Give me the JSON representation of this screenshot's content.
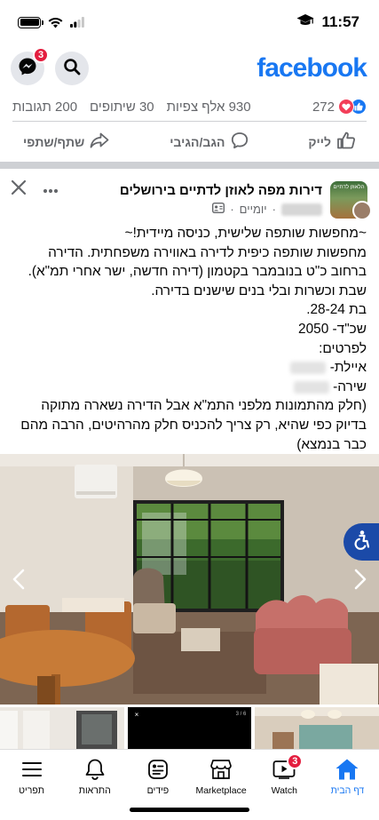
{
  "status": {
    "time": "11:57"
  },
  "header": {
    "logo": "facebook",
    "messenger_badge": "3"
  },
  "stats": {
    "reactions_count": "272",
    "comments": "200 תגובות",
    "shares": "30 שיתופים",
    "views": "930 אלף צפיות"
  },
  "actions": {
    "like": "לייק",
    "comment": "הגב/הגיבי",
    "share": "שתף/שתפי"
  },
  "post": {
    "group_name": "דירות מפה לאוזן לדתיים בירושלים",
    "avatar_text": "הלאוזן לדתיים",
    "time": "יומיים",
    "lines": [
      "~מחפשות שותפה שלישית, כניסה מיידית!~",
      "מחפשות שותפה כיפית לדירה באווירה משפחתית. הדירה ברחוב כ\"ט בנובמבר בקטמון (דירה חדשה, ישר אחרי תמ\"א).",
      "שבת וכשרות ובלי בנים שישנים בדירה.",
      "בת 28-24.",
      "שכ\"ד- 2050",
      "לפרטים:",
      "איילת-",
      "שירה-",
      "(חלק מהתמונות מלפני התמ\"א אבל הדירה נשארה מתוקה בדיוק כפי שהיא, רק צריך להכניס חלק מהרהיטים, הרבה מהם כבר בנמצא)"
    ]
  },
  "thumb_counter": "3 / 6",
  "tabs": [
    {
      "label": "דף הבית",
      "icon": "home-icon",
      "active": true
    },
    {
      "label": "Watch",
      "icon": "watch-icon",
      "badge": "3"
    },
    {
      "label": "Marketplace",
      "icon": "marketplace-icon"
    },
    {
      "label": "פידים",
      "icon": "feeds-icon"
    },
    {
      "label": "התראות",
      "icon": "bell-icon"
    },
    {
      "label": "תפריט",
      "icon": "menu-icon"
    }
  ],
  "colors": {
    "brand": "#1877f2",
    "badge": "#e41e3f",
    "love": "#f33e58"
  }
}
